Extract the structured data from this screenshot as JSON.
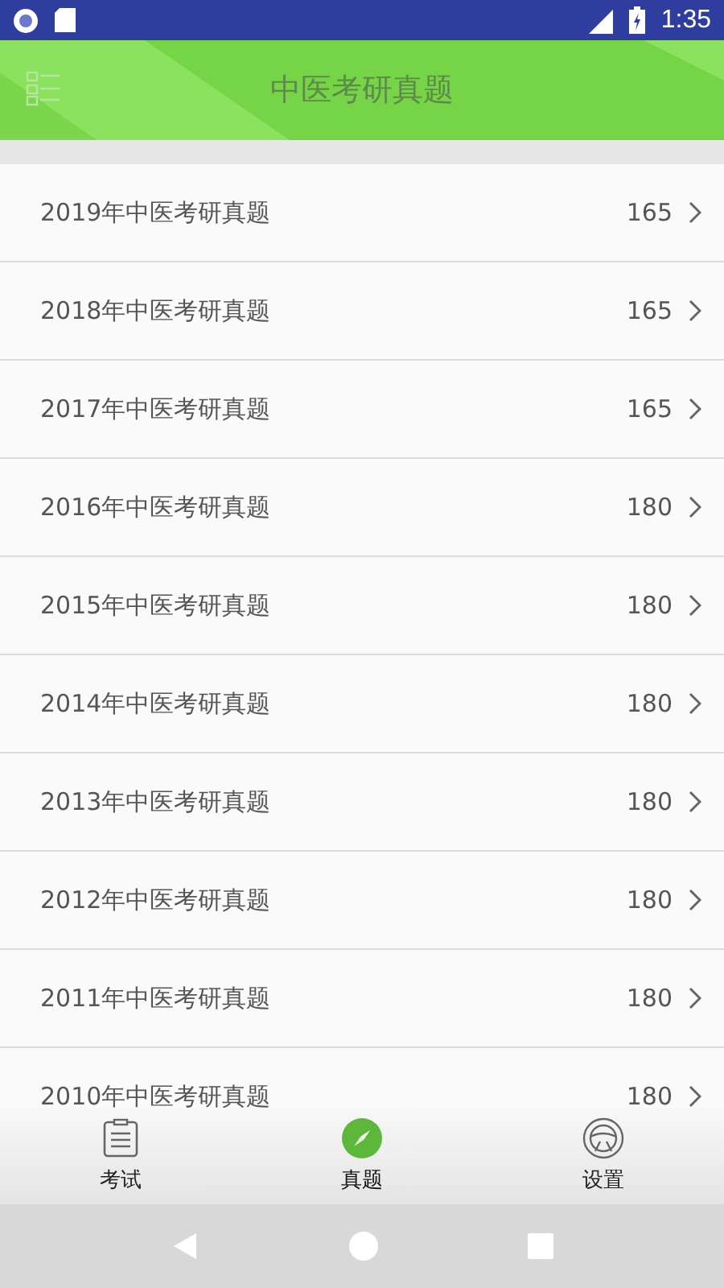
{
  "status_bar": {
    "time": "1:35"
  },
  "header": {
    "title": "中医考研真题"
  },
  "items": [
    {
      "title": "2019年中医考研真题",
      "count": "165"
    },
    {
      "title": "2018年中医考研真题",
      "count": "165"
    },
    {
      "title": "2017年中医考研真题",
      "count": "165"
    },
    {
      "title": "2016年中医考研真题",
      "count": "180"
    },
    {
      "title": "2015年中医考研真题",
      "count": "180"
    },
    {
      "title": "2014年中医考研真题",
      "count": "180"
    },
    {
      "title": "2013年中医考研真题",
      "count": "180"
    },
    {
      "title": "2012年中医考研真题",
      "count": "180"
    },
    {
      "title": "2011年中医考研真题",
      "count": "180"
    },
    {
      "title": "2010年中医考研真题",
      "count": "180"
    }
  ],
  "tabs": [
    {
      "label": "考试",
      "kind": "exam",
      "selected": false
    },
    {
      "label": "真题",
      "kind": "papers",
      "selected": true
    },
    {
      "label": "设置",
      "kind": "settings",
      "selected": false
    }
  ]
}
